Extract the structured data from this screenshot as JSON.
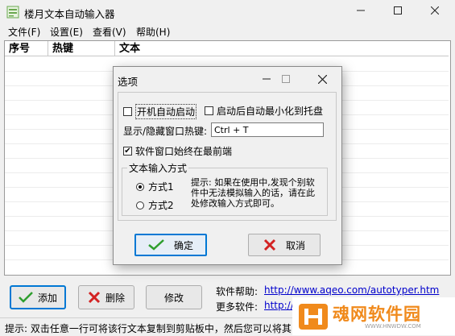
{
  "window": {
    "title": "楼月文本自动输入器"
  },
  "menu": [
    "文件(F)",
    "设置(E)",
    "查看(V)",
    "帮助(H)"
  ],
  "table": {
    "headers": [
      "序号",
      "热键",
      "文本"
    ],
    "rows": []
  },
  "buttons": {
    "add": "添加",
    "delete": "删除",
    "edit": "修改"
  },
  "links": {
    "help_label": "软件帮助:",
    "help_url": "http://www.aqeo.com/autotyper.htm",
    "more_label": "更多软件:",
    "more_url": "http://"
  },
  "status": {
    "text": "提示: 双击任意一行可将该行文本复制到剪贴板中，然后您可以将其"
  },
  "dialog": {
    "title": "选项",
    "autostart_label": "开机自动启动",
    "autostart_checked": false,
    "minimize_label": "启动后自动最小化到托盘",
    "minimize_checked": false,
    "hotkey_label": "显示/隐藏窗口热键:",
    "hotkey_value": "Ctrl + T",
    "topmost_label": "软件窗口始终在最前端",
    "topmost_checked": true,
    "group_title": "文本输入方式",
    "method1_label": "方式1",
    "method2_label": "方式2",
    "selected_method": 1,
    "hint": "提示: 如果在使用中,发现个别软件中无法模拟输入的话，请在此处修改输入方式即可。",
    "ok_label": "确定",
    "cancel_label": "取消"
  },
  "watermark": {
    "text": "魂网软件园",
    "sub": "WWW.HNWDW.COM"
  },
  "colors": {
    "accent": "#0078d4",
    "ok_check": "#2e9e2e",
    "cancel_x": "#d32222",
    "watermark": "#f08a1c"
  }
}
